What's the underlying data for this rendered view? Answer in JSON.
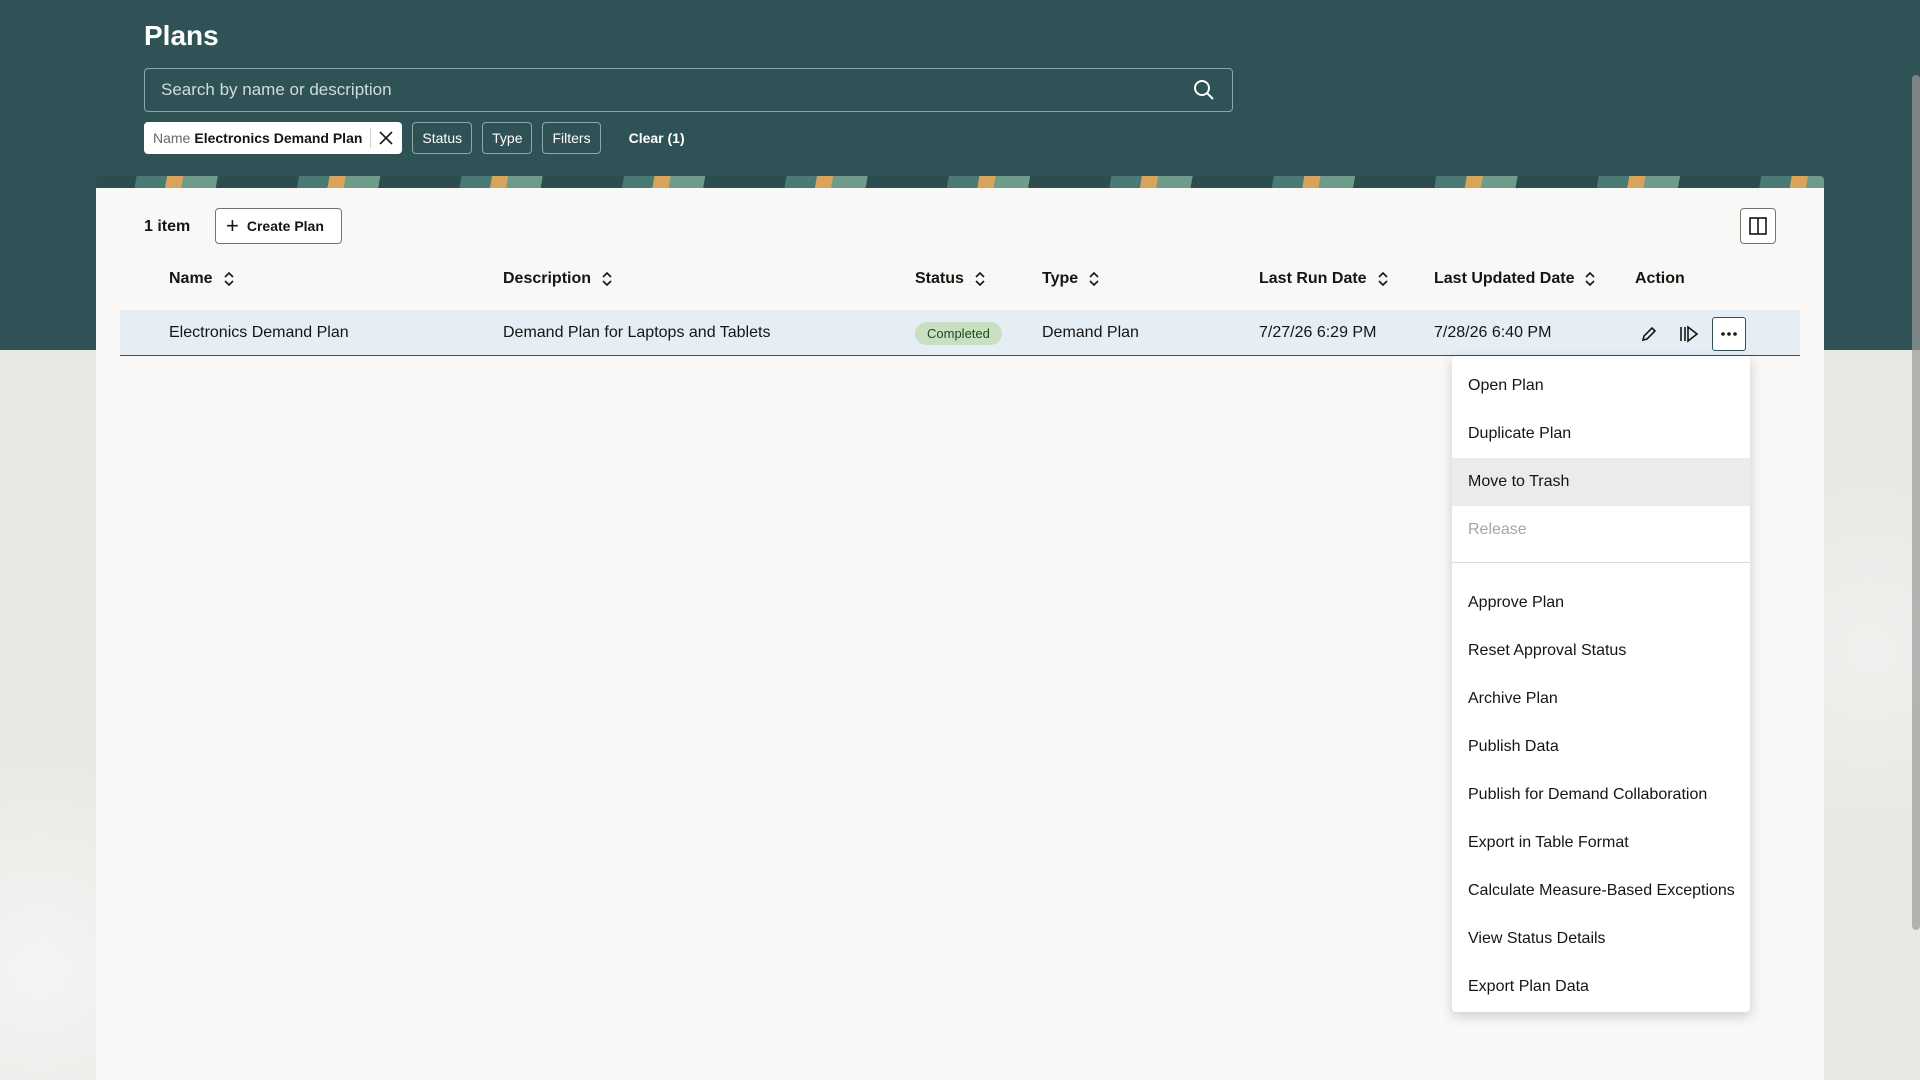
{
  "page": {
    "title": "Plans"
  },
  "search": {
    "placeholder": "Search by name or description",
    "value": ""
  },
  "filters": {
    "active_chip": {
      "key": "Name",
      "value": "Electronics Demand Plan"
    },
    "chips": [
      "Status",
      "Type",
      "Filters"
    ],
    "clear_label": "Clear (1)"
  },
  "toolbar": {
    "count_label": "1 item",
    "create_label": "Create Plan"
  },
  "table": {
    "columns": [
      "Name",
      "Description",
      "Status",
      "Type",
      "Last Run Date",
      "Last Updated Date",
      "Action"
    ],
    "rows": [
      {
        "name": "Electronics Demand Plan",
        "description": "Demand Plan for Laptops and Tablets",
        "status": "Completed",
        "type": "Demand Plan",
        "last_run": "7/27/26 6:29 PM",
        "last_updated": "7/28/26 6:40 PM"
      }
    ]
  },
  "actions_menu": {
    "items_group1": [
      "Open Plan",
      "Duplicate Plan",
      "Move to Trash",
      "Release"
    ],
    "items_group2": [
      "Approve Plan",
      "Reset Approval Status",
      "Archive Plan",
      "Publish Data",
      "Publish for Demand Collaboration",
      "Export in Table Format",
      "Calculate Measure-Based Exceptions",
      "View Status Details",
      "Export Plan Data"
    ],
    "hovered": "Move to Trash",
    "disabled": [
      "Release"
    ]
  },
  "colors": {
    "header_bg": "#2f5256",
    "row_selected": "#e4eef4",
    "status_completed": "#c8e0c1"
  }
}
